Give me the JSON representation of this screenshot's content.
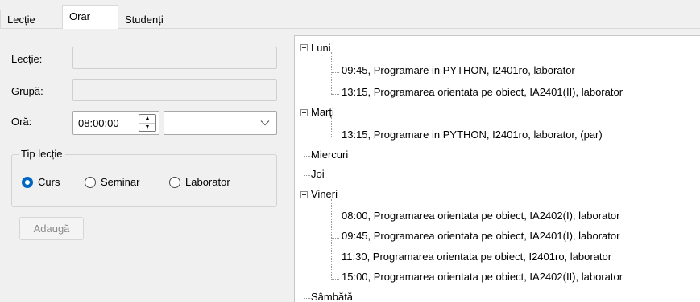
{
  "tabs": [
    {
      "label": "Lecție",
      "active": false
    },
    {
      "label": "Orar",
      "active": true
    },
    {
      "label": "Studenți",
      "active": false
    }
  ],
  "form": {
    "lectie_label": "Lecție:",
    "lectie_value": "",
    "grupa_label": "Grupă:",
    "grupa_value": "",
    "ora_label": "Oră:",
    "ora_value": "08:00:00",
    "parity_selected": "-",
    "tip_lectie_legend": "Tip lecție",
    "radios": [
      {
        "label": "Curs",
        "checked": true
      },
      {
        "label": "Seminar",
        "checked": false
      },
      {
        "label": "Laborator",
        "checked": false
      }
    ],
    "add_button": "Adaugă"
  },
  "schedule": {
    "days": [
      {
        "name": "Luni",
        "expanded": true,
        "items": [
          "09:45, Programare in PYTHON, I2401ro, laborator",
          "13:15, Programarea orientata pe obiect, IA2401(II), laborator"
        ]
      },
      {
        "name": "Marți",
        "expanded": true,
        "items": [
          "13:15, Programare in PYTHON, I2401ro, laborator, (par)"
        ]
      },
      {
        "name": "Miercuri",
        "expanded": false,
        "items": []
      },
      {
        "name": "Joi",
        "expanded": false,
        "items": []
      },
      {
        "name": "Vineri",
        "expanded": true,
        "items": [
          "08:00, Programarea orientata pe obiect, IA2402(I), laborator",
          "09:45, Programarea orientata pe obiect, IA2401(I), laborator",
          "11:30, Programarea orientata pe obiect, I2401ro, laborator",
          "15:00, Programarea orientata pe obiect, IA2402(II), laborator"
        ]
      },
      {
        "name": "Sâmbătă",
        "expanded": false,
        "items": []
      }
    ]
  },
  "colors": {
    "accent": "#0067c0",
    "window_bg": "#f0f0f0"
  }
}
